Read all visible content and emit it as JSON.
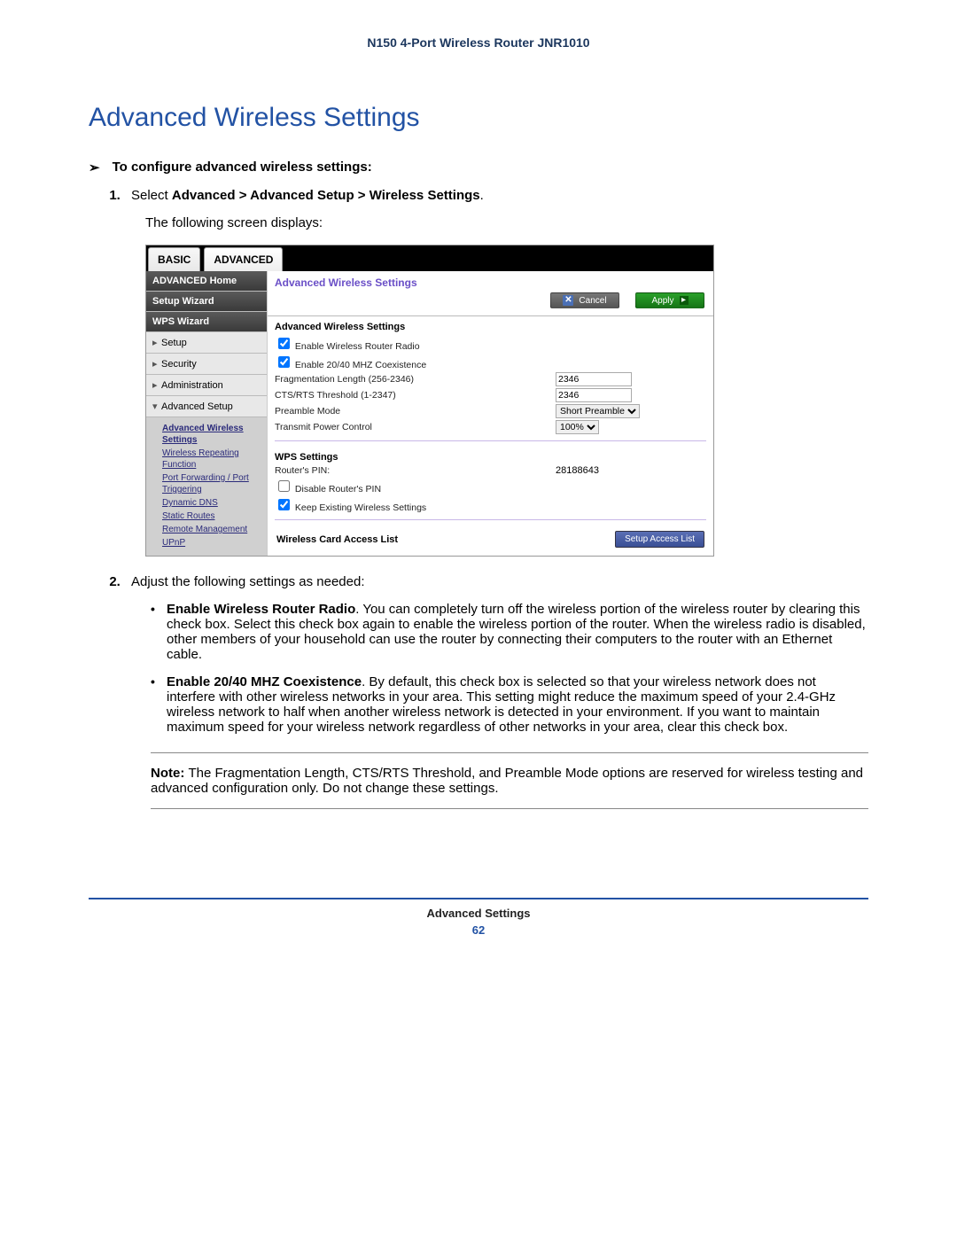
{
  "doc_header": "N150 4-Port Wireless Router JNR1010",
  "h1": "Advanced Wireless Settings",
  "proc_arrow": "➢",
  "proc_heading": "To configure advanced wireless settings:",
  "step1_prefix": "Select ",
  "step1_bold": "Advanced > Advanced Setup > Wireless Settings",
  "step1_suffix": ".",
  "step1_follow": "The following screen displays:",
  "ui": {
    "tab_basic": "BASIC",
    "tab_advanced": "ADVANCED",
    "side": {
      "adv_home": "ADVANCED Home",
      "setup_wizard": "Setup Wizard",
      "wps_wizard": "WPS Wizard",
      "setup": "Setup",
      "security": "Security",
      "administration": "Administration",
      "adv_setup": "Advanced Setup",
      "sub": {
        "adv_wireless": "Advanced Wireless Settings",
        "wrf": "Wireless Repeating Function",
        "pft": "Port Forwarding / Port Triggering",
        "ddns": "Dynamic DNS",
        "static": "Static Routes",
        "remote": "Remote Management",
        "upnp": "UPnP"
      }
    },
    "title": "Advanced Wireless Settings",
    "cancel": "Cancel",
    "apply": "Apply",
    "sec_aws": "Advanced Wireless Settings",
    "cb_radio": "Enable Wireless Router Radio",
    "cb_coex": "Enable 20/40 MHZ Coexistence",
    "lbl_frag": "Fragmentation Length (256-2346)",
    "val_frag": "2346",
    "lbl_cts": "CTS/RTS Threshold (1-2347)",
    "val_cts": "2346",
    "lbl_preamble": "Preamble Mode",
    "val_preamble": "Short Preamble",
    "lbl_txpwr": "Transmit Power Control",
    "val_txpwr": "100%",
    "sec_wps": "WPS Settings",
    "lbl_pin": "Router's PIN:",
    "val_pin": "28188643",
    "cb_disable_pin": "Disable Router's PIN",
    "cb_keep": "Keep Existing Wireless Settings",
    "sec_acl": "Wireless Card Access List",
    "btn_acl": "Setup Access List"
  },
  "step2": "Adjust the following settings as needed:",
  "bullet1_bold": "Enable Wireless Router Radio",
  "bullet1_text": ". You can completely turn off the wireless portion of the wireless router by clearing this check box. Select this check box again to enable the wireless portion of the router. When the wireless radio is disabled, other members of your household can use the router by connecting their computers to the router with an Ethernet cable.",
  "bullet2_bold": "Enable 20/40 MHZ Coexistence",
  "bullet2_text": ". By default, this check box is selected so that your wireless network does not interfere with other wireless networks in your area. This setting might reduce the maximum speed of your 2.4-GHz wireless network to half when another wireless network is detected in your environment. If you want to maintain maximum speed for your wireless network regardless of other networks in your area, clear this check box.",
  "note_label": "Note:  ",
  "note_text": "The Fragmentation Length, CTS/RTS Threshold, and Preamble Mode options are reserved for wireless testing and advanced configuration only. Do not change these settings.",
  "footer_title": "Advanced Settings",
  "page_number": "62"
}
